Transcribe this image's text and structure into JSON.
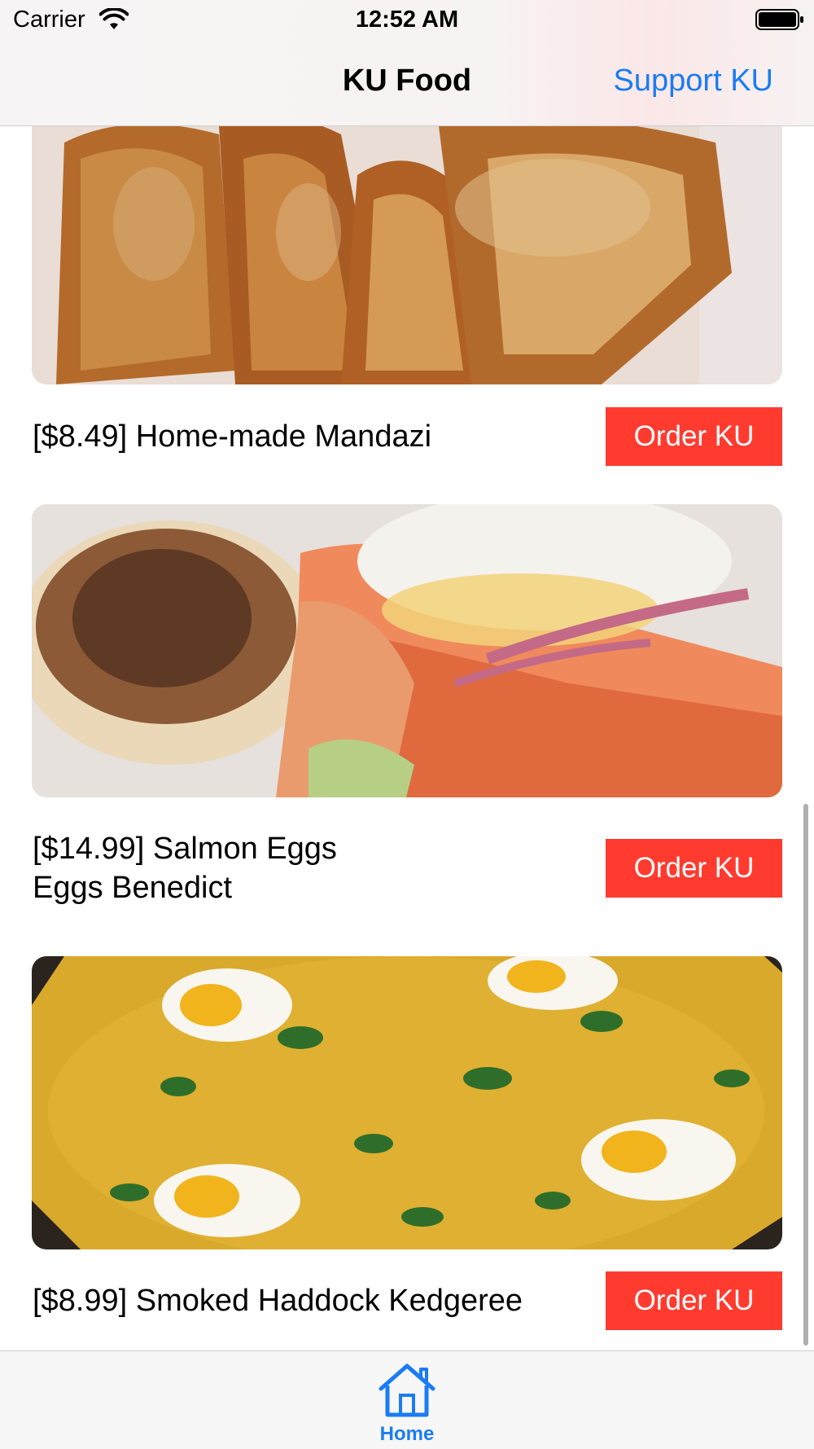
{
  "status_bar": {
    "carrier": "Carrier",
    "time": "12:52 AM",
    "wifi_icon": "wifi-icon",
    "battery_icon": "battery-full-icon"
  },
  "nav": {
    "title": "KU Food",
    "action": "Support KU",
    "action_color": "#1a7cf5"
  },
  "items": [
    {
      "label": "[$8.49] Home-made Mandazi",
      "button": "Order KU",
      "image": "mandazi-photo"
    },
    {
      "label": "[$14.99] Salmon Eggs Eggs Benedict",
      "button": "Order KU",
      "image": "salmon-eggs-benedict-photo"
    },
    {
      "label": "[$8.99] Smoked Haddock Kedgeree",
      "button": "Order KU",
      "image": "kedgeree-photo"
    }
  ],
  "button_color": "#ff3b30",
  "tab_bar": {
    "tabs": [
      {
        "label": "Home",
        "icon": "home-icon",
        "selected": true
      }
    ]
  }
}
